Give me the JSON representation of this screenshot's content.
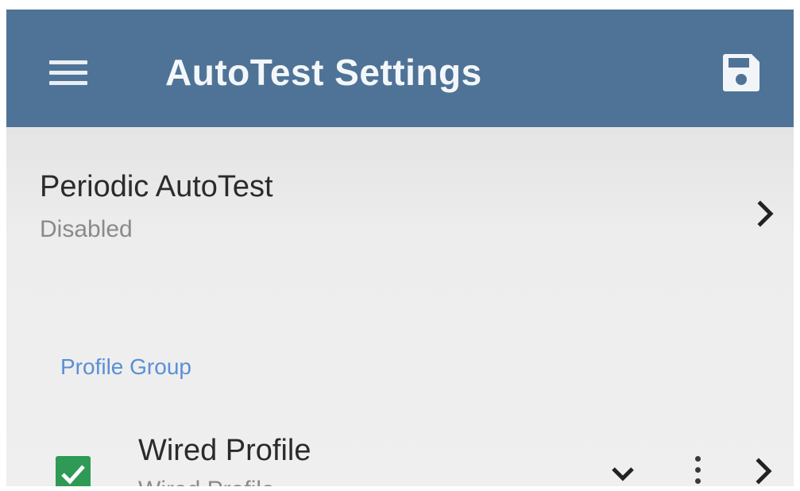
{
  "appbar": {
    "title": "AutoTest Settings",
    "color": "#4f7397",
    "menu_icon": "hamburger-menu-icon",
    "save_icon": "floppy-disk-icon"
  },
  "periodic": {
    "title": "Periodic AutoTest",
    "status": "Disabled",
    "icon": "chevron-right-icon"
  },
  "profile_group": {
    "header": "Profile Group",
    "header_color": "#5a8fd6",
    "profiles": [
      {
        "title": "Wired Profile",
        "subtitle": "Wired Profile",
        "checked": true,
        "checkbox_color": "#2e9a55",
        "icons": [
          "checkbox-checked-icon",
          "chevron-down-icon",
          "more-vertical-icon",
          "chevron-right-icon"
        ]
      }
    ]
  }
}
